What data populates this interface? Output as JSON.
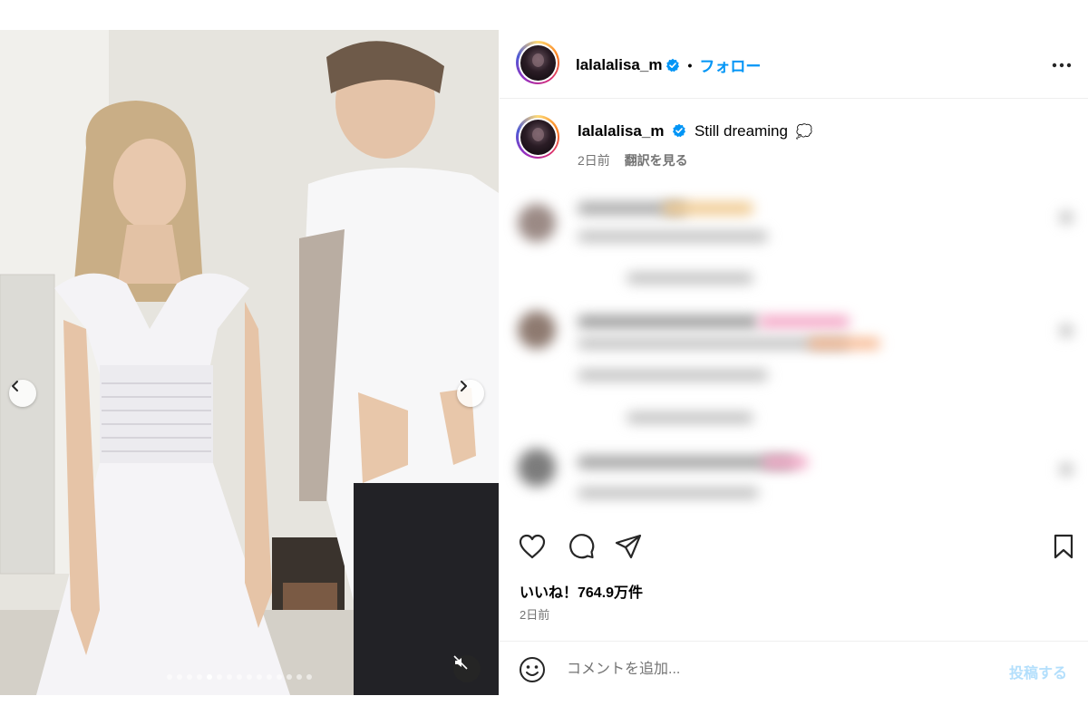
{
  "post": {
    "username": "lalalalisa_m",
    "separator": "•",
    "follow_label": "フォロー",
    "caption_text": "Still dreaming",
    "caption_emoji": "💭",
    "caption_age": "2日前",
    "translate_label": "翻訳を見る",
    "likes_label": "いいね！764.9万件",
    "post_age": "2日前"
  },
  "media": {
    "carousel_total": 15,
    "carousel_active_index": 4,
    "muted": true
  },
  "comment_box": {
    "placeholder": "コメントを追加...",
    "post_label": "投稿する"
  },
  "icons": {
    "verified": "verified-badge-icon",
    "more": "more-options-icon",
    "like": "heart-icon",
    "comment": "comment-icon",
    "share": "share-icon",
    "save": "bookmark-icon",
    "emoji": "emoji-icon",
    "prev": "chevron-left-icon",
    "next": "chevron-right-icon",
    "mute": "muted-speaker-icon"
  },
  "colors": {
    "accent": "#0095f6",
    "post_button_disabled": "#b3dffc",
    "secondary_text": "#737373",
    "verified": "#0095f6"
  }
}
